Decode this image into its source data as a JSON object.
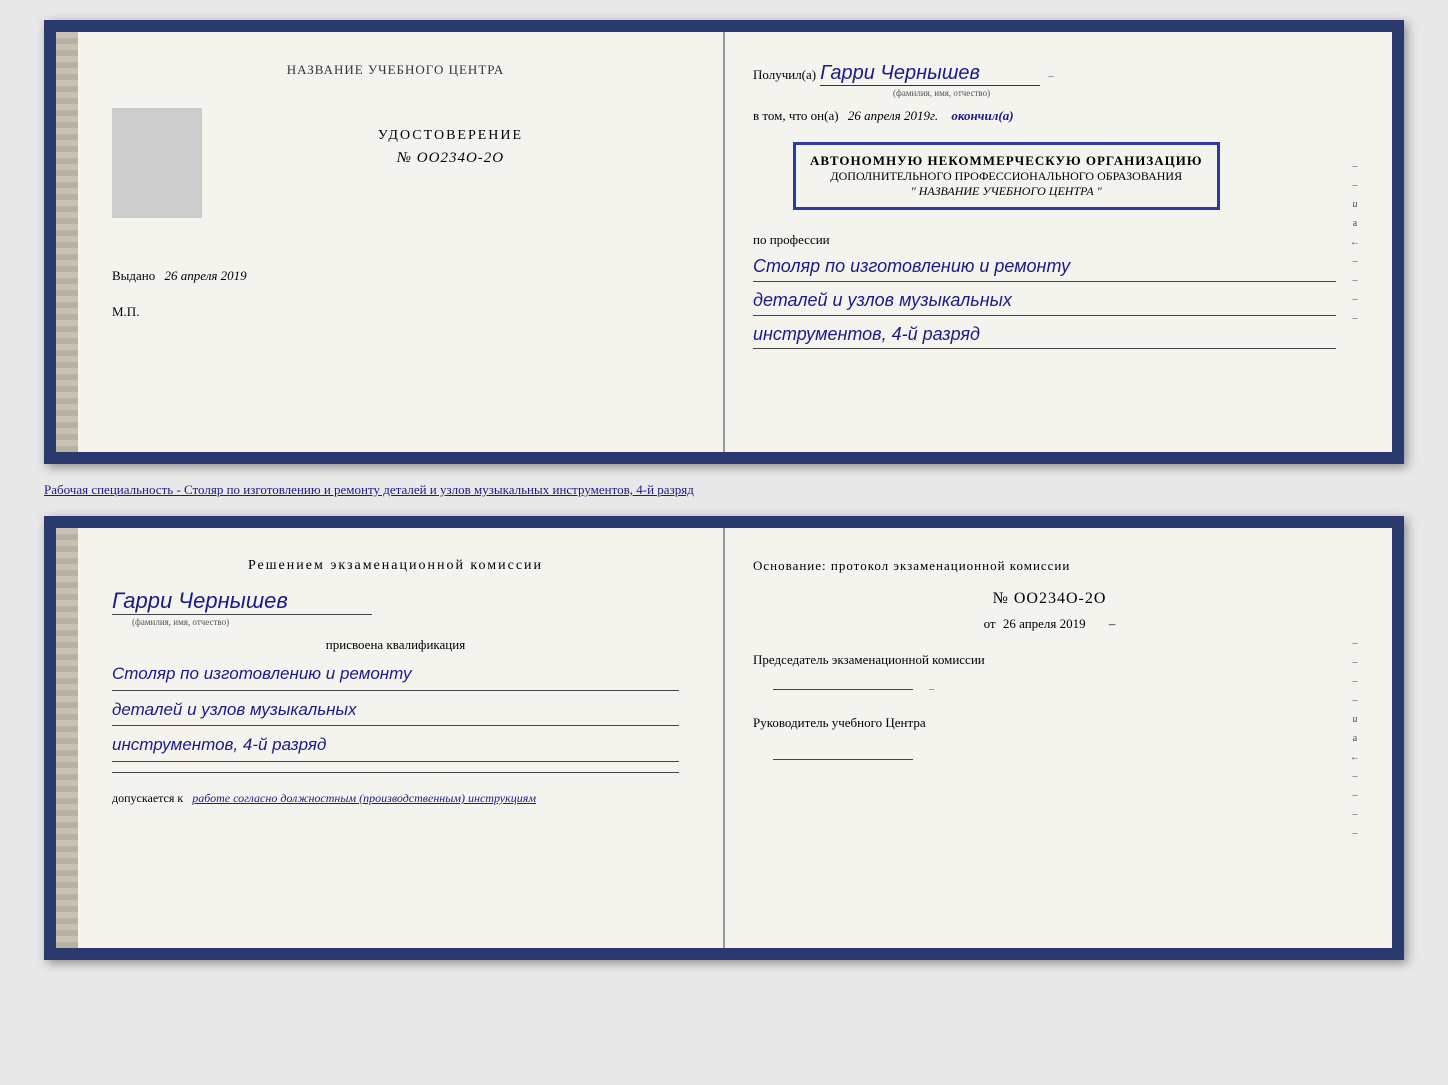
{
  "top_left": {
    "org_name": "НАЗВАНИЕ УЧЕБНОГО ЦЕНТРА",
    "cert_label": "УДОСТОВЕРЕНИЕ",
    "cert_number": "№ OO234O-2O",
    "issued_prefix": "Выдано",
    "issued_date": "26 апреля 2019",
    "mp_label": "М.П."
  },
  "top_right": {
    "recipient_prefix": "Получил(а)",
    "recipient_name": "Гарри Чернышев",
    "fio_hint": "(фамилия, имя, отчество)",
    "tom_line": "в том, что он(а)",
    "date_value": "26 апреля 2019г.",
    "finished_label": "окончил(а)",
    "stamp_line1": "АВТОНОМНУЮ НЕКОММЕРЧЕСКУЮ ОРГАНИЗАЦИЮ",
    "stamp_line2": "ДОПОЛНИТЕЛЬНОГО ПРОФЕССИОНАЛЬНОГО ОБРАЗОВАНИЯ",
    "stamp_line3": "\" НАЗВАНИЕ УЧЕБНОГО ЦЕНТРА \"",
    "profession_label": "по профессии",
    "profession_line1": "Столяр по изготовлению и ремонту",
    "profession_line2": "деталей и узлов музыкальных",
    "profession_line3": "инструментов, 4-й разряд",
    "side_marks": [
      "–",
      "–",
      "и",
      "а",
      "←",
      "–",
      "–",
      "–",
      "–"
    ]
  },
  "specialty_bar": {
    "text": "Рабочая специальность - Столяр по изготовлению и ремонту деталей и узлов музыкальных инструментов, 4-й разряд"
  },
  "bottom_left": {
    "commission_title": "Решением  экзаменационной  комиссии",
    "person_name": "Гарри Чернышев",
    "fio_hint": "(фамилия, имя, отчество)",
    "qualification_label": "присвоена квалификация",
    "qualification_line1": "Столяр по изготовлению и ремонту",
    "qualification_line2": "деталей и узлов музыкальных",
    "qualification_line3": "инструментов, 4-й разряд",
    "access_prefix": "допускается к",
    "access_text": "работе согласно должностным (производственным) инструкциям"
  },
  "bottom_right": {
    "basis_title": "Основание:  протокол  экзаменационной  комиссии",
    "protocol_number": "№  OO234O-2O",
    "protocol_date_prefix": "от",
    "protocol_date": "26 апреля 2019",
    "chairman_label": "Председатель экзаменационной комиссии",
    "head_label": "Руководитель учебного Центра",
    "side_marks": [
      "–",
      "–",
      "–",
      "–",
      "и",
      "а",
      "←",
      "–",
      "–",
      "–",
      "–"
    ]
  }
}
